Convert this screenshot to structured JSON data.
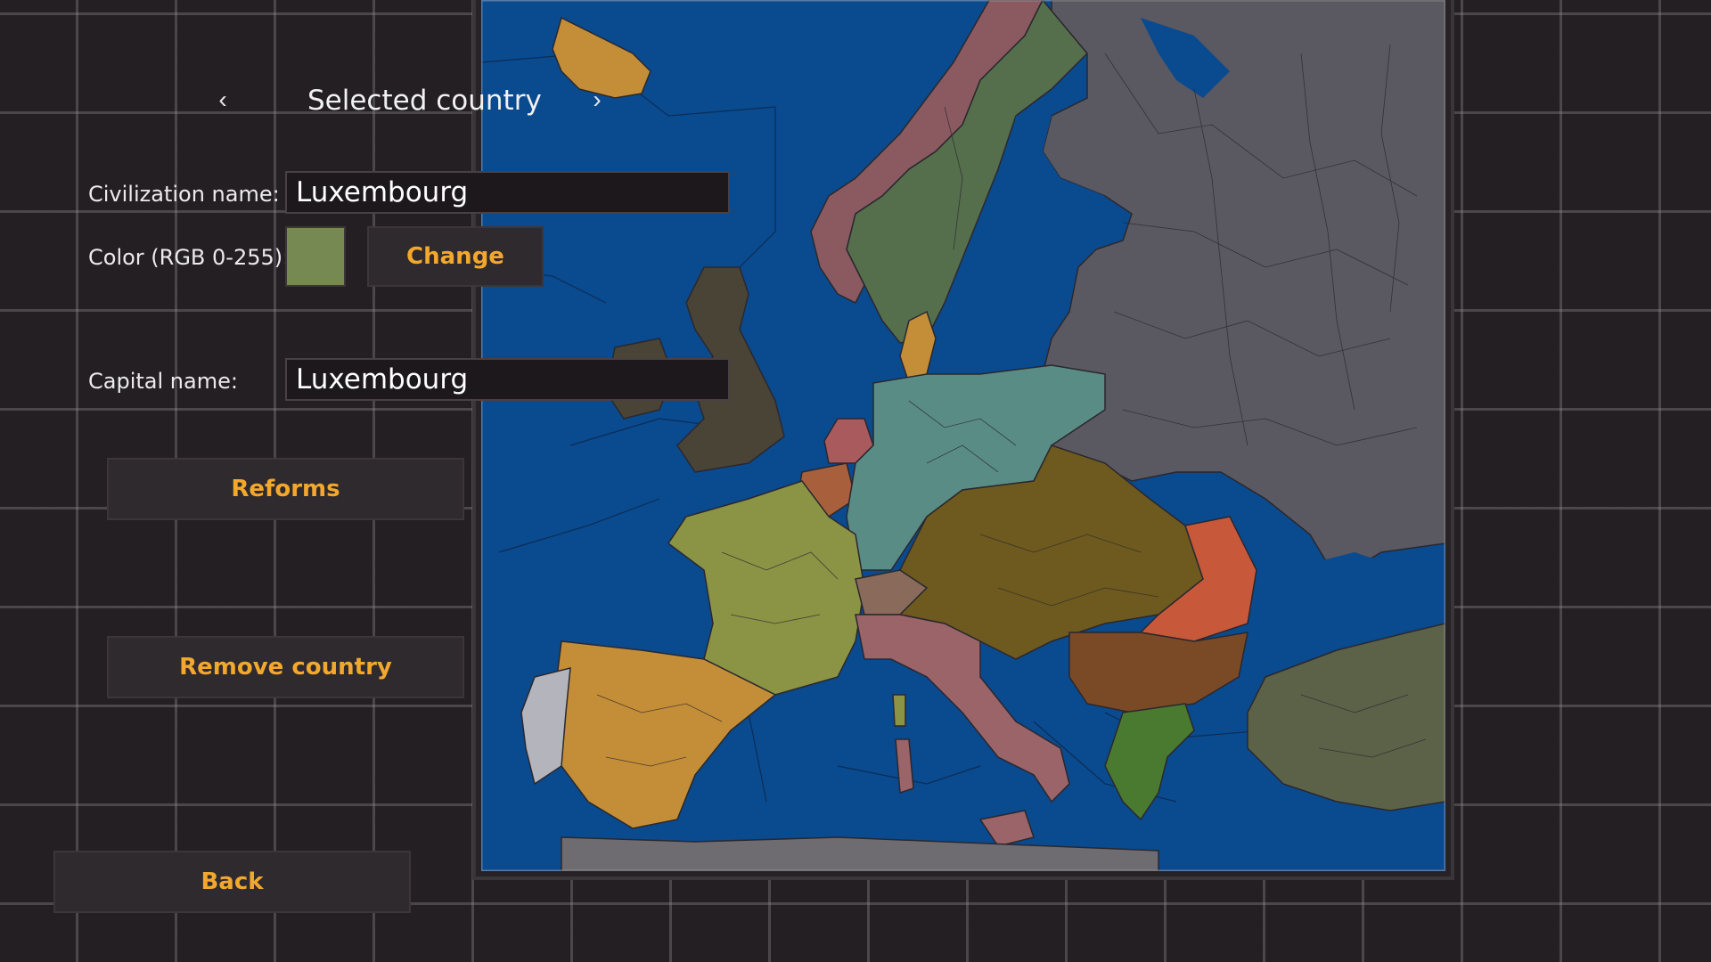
{
  "header": {
    "title": "Selected country",
    "prev_icon": "chevron-left-icon",
    "next_icon": "chevron-right-icon"
  },
  "civilization": {
    "label": "Civilization name:",
    "value": "Luxembourg"
  },
  "color": {
    "label": "Color (RGB 0-255):",
    "swatch": "#768953",
    "change_label": "Change"
  },
  "capital": {
    "label": "Capital name:",
    "value": "Luxembourg"
  },
  "buttons": {
    "reforms": "Reforms",
    "remove": "Remove country",
    "back": "Back"
  },
  "colors": {
    "accent": "#f2a82c",
    "sea": "#0a4a8f",
    "russia": "#5a5860",
    "scandinavia_norway": "#8a5a60",
    "sweden": "#556e4c",
    "uk": "#4a4436",
    "france": "#8b9345",
    "spain": "#c48e38",
    "portugal": "#b4b4bc",
    "germany": "#5a8c86",
    "austria_hungary": "#6e5a1e",
    "italy": "#9a6468",
    "romania": "#c8583a",
    "serbia_bulgaria": "#7a4a26",
    "greece": "#4a7a30",
    "ottoman": "#5c6248",
    "netherlands": "#a85a5c",
    "belgium": "#a8603c",
    "switzerland": "#8a6a5a",
    "denmark": "#c48e38",
    "iceland": "#c48e38"
  }
}
